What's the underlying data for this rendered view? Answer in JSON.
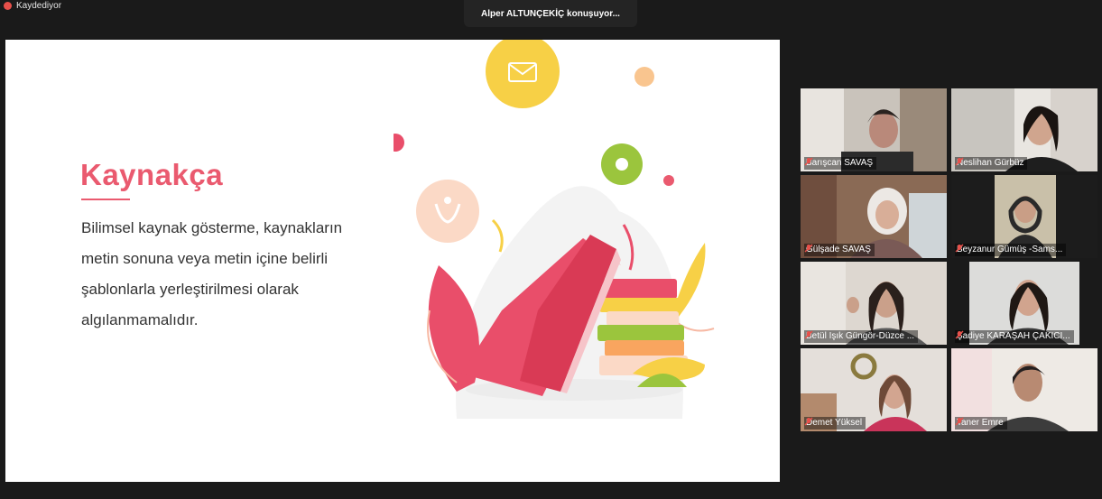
{
  "recording": {
    "label": "Kaydediyor"
  },
  "speaker_banner": {
    "text": "Alper ALTUNÇEKİÇ konuşuyor..."
  },
  "slide": {
    "title": "Kaynakça",
    "body_lines": [
      "Bilimsel kaynak gösterme, kaynakların",
      "metin sonuna veya metin içine belirli",
      "şablonlarla yerleştirilmesi olarak",
      "algılanmamalıdır."
    ]
  },
  "participants": [
    {
      "name": "Barışcan SAVAŞ"
    },
    {
      "name": "Neslihan Gürbüz"
    },
    {
      "name": "Gülşade SAVAŞ"
    },
    {
      "name": "Beyzanur Gümüş -Sams..."
    },
    {
      "name": "Betül Işık Güngör-Düzce ..."
    },
    {
      "name": "Şadiye KARAŞAH ÇAKICI..."
    },
    {
      "name": "Demet Yüksel"
    },
    {
      "name": "Taner Emre"
    }
  ],
  "colors": {
    "accent": "#ea5a6f",
    "background": "#1a1a1a",
    "muted_mic": "#e8504a"
  }
}
